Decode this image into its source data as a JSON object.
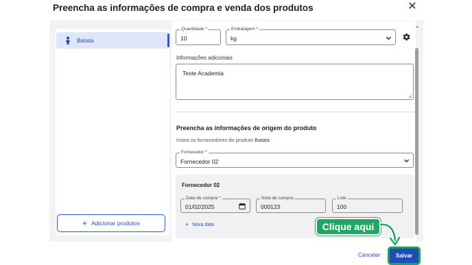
{
  "dialog": {
    "title": "Preencha as informações de compra e venda dos produtos"
  },
  "sidebar": {
    "items": [
      {
        "label": "Batata",
        "selected": true
      }
    ],
    "add_products_label": "Adicionar produtos"
  },
  "product_form": {
    "quantity": {
      "label": "Quantidade",
      "value": "10"
    },
    "packaging": {
      "label": "Embalagem",
      "value": "kg"
    },
    "additional_info": {
      "label": "Informações adicionais",
      "value": "Teste Academia"
    }
  },
  "origin_section": {
    "title": "Preencha as informações de origem do produto",
    "subtitle_prefix": "Insira os fornecedores do produto",
    "subtitle_product": "Batata",
    "supplier_select": {
      "label": "Fornecedor",
      "value": "Fornecedor 02"
    }
  },
  "supplier_card": {
    "title": "Fornecedor 02",
    "purchase_date": {
      "label": "Data de compra",
      "value": "01/02/2025"
    },
    "purchase_note": {
      "label": "Nota de compra",
      "value": "000123"
    },
    "lot": {
      "label": "Lote",
      "value": "100"
    },
    "new_date_label": "Nova data"
  },
  "footer": {
    "cancel_label": "Cancelar",
    "save_label": "Salvar"
  },
  "annotation": {
    "callout_text": "Clique aqui"
  },
  "colors": {
    "primary": "#1e4cb8",
    "highlight_green": "#23a565",
    "required": "#d0021b",
    "selected_bg": "#dfe6fb"
  }
}
